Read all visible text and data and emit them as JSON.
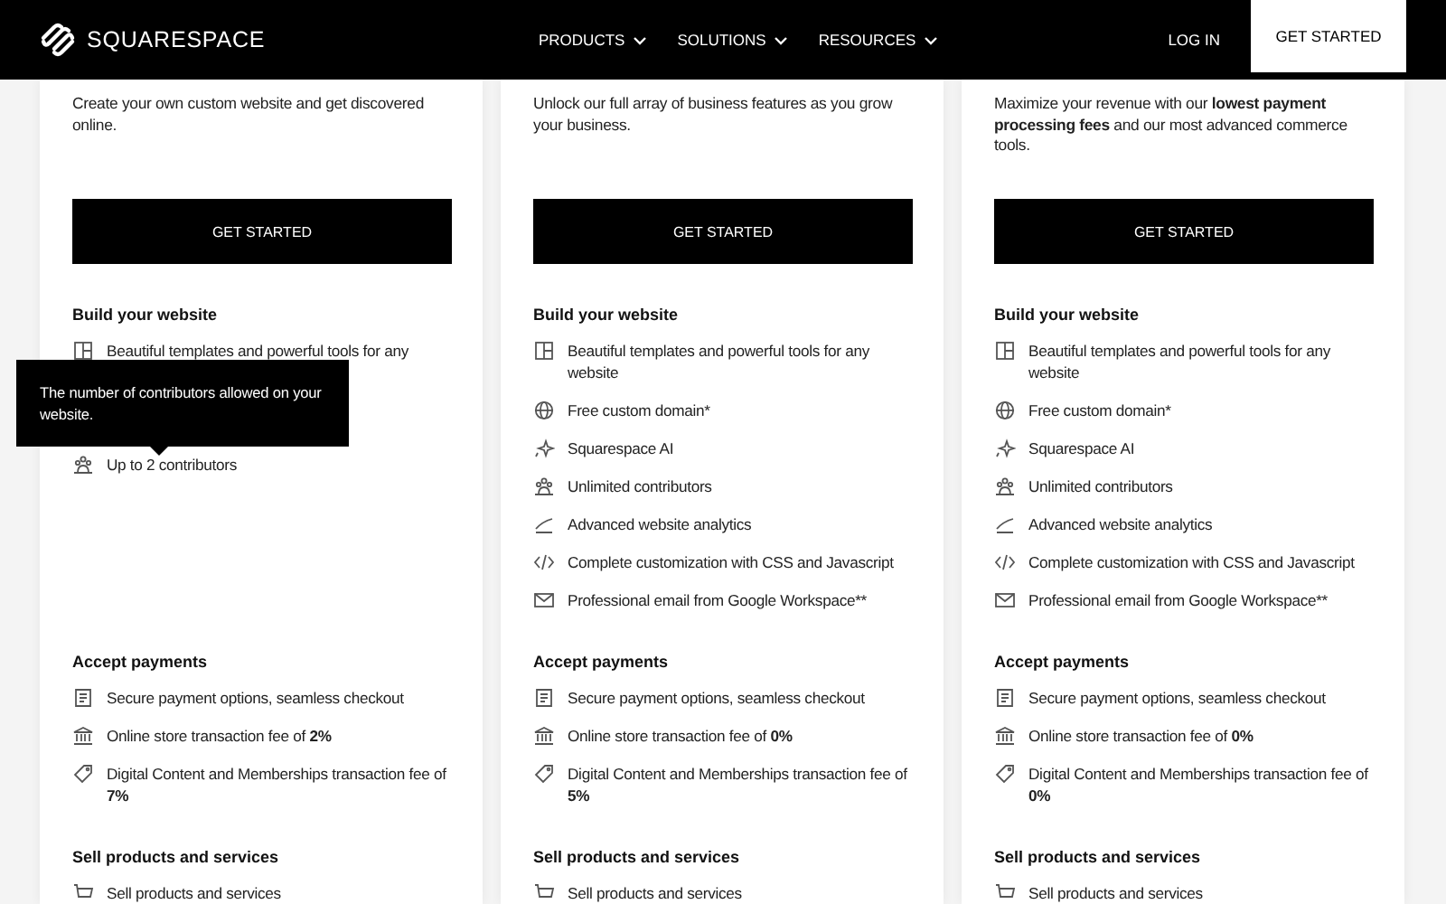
{
  "header": {
    "logo": "SQUARESPACE",
    "nav": [
      {
        "label": "PRODUCTS"
      },
      {
        "label": "SOLUTIONS"
      },
      {
        "label": "RESOURCES"
      }
    ],
    "login": "LOG IN",
    "cta": "GET STARTED"
  },
  "plans": [
    {
      "description": "Create your own custom website and get discovered online.",
      "button": "GET STARTED",
      "sections": [
        {
          "title": "Build your website",
          "items": [
            {
              "kind": "layout",
              "text": "Beautiful templates and powerful tools for any"
            },
            {
              "kind": "people",
              "text": "Up to 2 contributors",
              "tooltip": "The number of contributors allowed on your website."
            }
          ]
        },
        {
          "title": "Accept payments",
          "items": [
            {
              "kind": "receipt",
              "text": "Secure payment options, seamless checkout"
            },
            {
              "kind": "bank",
              "text": "Online store transaction fee of **2%**"
            },
            {
              "kind": "tag",
              "text": "Digital Content and Memberships transaction fee of **7%**"
            }
          ]
        },
        {
          "title": "Sell products and services",
          "items": [
            {
              "kind": "cart",
              "text": "Sell products and services"
            }
          ]
        }
      ]
    },
    {
      "description": "Unlock our full array of business features as you grow your business.",
      "button": "GET STARTED",
      "sections": [
        {
          "title": "Build your website",
          "items": [
            {
              "kind": "layout",
              "text": "Beautiful templates and powerful tools for any website"
            },
            {
              "kind": "globe",
              "text": "Free custom domain*"
            },
            {
              "kind": "sparkle",
              "text": "Squarespace AI"
            },
            {
              "kind": "people",
              "text": "Unlimited contributors"
            },
            {
              "kind": "chart",
              "text": "Advanced website analytics"
            },
            {
              "kind": "code",
              "text": "Complete customization with CSS and Javascript"
            },
            {
              "kind": "mail",
              "text": "Professional email from Google Workspace**"
            }
          ]
        },
        {
          "title": "Accept payments",
          "items": [
            {
              "kind": "receipt",
              "text": "Secure payment options, seamless checkout"
            },
            {
              "kind": "bank",
              "text": "Online store transaction fee of **0%**"
            },
            {
              "kind": "tag",
              "text": "Digital Content and Memberships transaction fee of **5%**"
            }
          ]
        },
        {
          "title": "Sell products and services",
          "items": [
            {
              "kind": "cart",
              "text": "Sell products and services"
            }
          ]
        }
      ]
    },
    {
      "description": "Maximize your revenue with our **lowest payment processing fees** and our most advanced commerce tools.",
      "button": "GET STARTED",
      "sections": [
        {
          "title": "Build your website",
          "items": [
            {
              "kind": "layout",
              "text": "Beautiful templates and powerful tools for any website"
            },
            {
              "kind": "globe",
              "text": "Free custom domain*"
            },
            {
              "kind": "sparkle",
              "text": "Squarespace AI"
            },
            {
              "kind": "people",
              "text": "Unlimited contributors"
            },
            {
              "kind": "chart",
              "text": "Advanced website analytics"
            },
            {
              "kind": "code",
              "text": "Complete customization with CSS and Javascript"
            },
            {
              "kind": "mail",
              "text": "Professional email from Google Workspace**"
            }
          ]
        },
        {
          "title": "Accept payments",
          "items": [
            {
              "kind": "receipt",
              "text": "Secure payment options, seamless checkout"
            },
            {
              "kind": "bank",
              "text": "Online store transaction fee of **0%**"
            },
            {
              "kind": "tag",
              "text": "Digital Content and Memberships transaction fee of **0%**"
            }
          ]
        },
        {
          "title": "Sell products and services",
          "items": [
            {
              "kind": "cart",
              "text": "Sell products and services"
            }
          ]
        }
      ]
    }
  ]
}
